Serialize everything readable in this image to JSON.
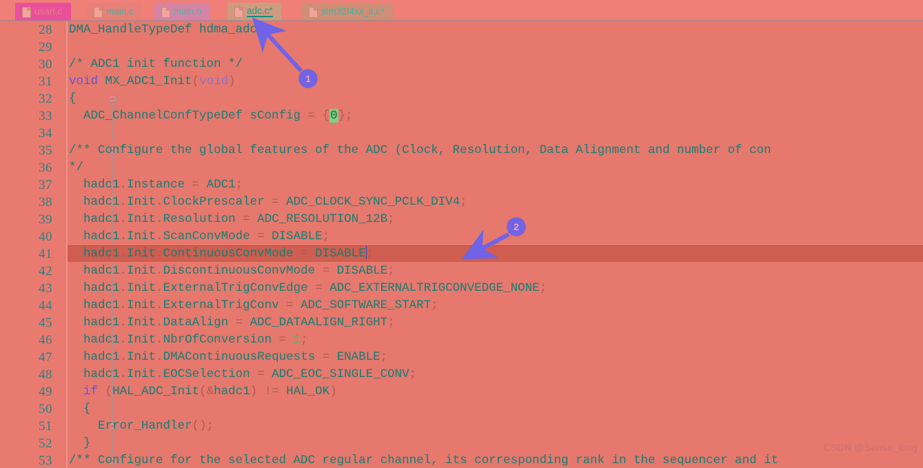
{
  "window": {
    "watermark": "CSDN @Sense_long"
  },
  "tabbar": {
    "tabs": [
      {
        "label": "usart.c",
        "icon": "file-icon",
        "active": false,
        "modified": false
      },
      {
        "label": "main.c",
        "icon": "file-icon",
        "active": false,
        "modified": false
      },
      {
        "label": "main.h",
        "icon": "file-icon",
        "active": false,
        "modified": false
      },
      {
        "label": "adc.c*",
        "icon": "file-icon",
        "active": true,
        "modified": true
      },
      {
        "label": "stm32f4xx_it.c*",
        "icon": "file-icon",
        "active": false,
        "modified": true
      }
    ]
  },
  "editor": {
    "active_line": 41,
    "first_visible_line": 28,
    "last_visible_line": 53,
    "colors": {
      "background": "#e6786e",
      "current_line": "#cf5d50",
      "line_number": "#2a7f84",
      "identifier": "#147e72",
      "keyword": "#6b4fd8",
      "comment": "#9b51c4",
      "number": "#3fc25c",
      "accent_badge": "#6f63e8"
    },
    "lines": [
      {
        "n": "28",
        "text": "DMA_HandleTypeDef hdma_adc1;"
      },
      {
        "n": "29",
        "text": ""
      },
      {
        "n": "30",
        "text": "/* ADC1 init function */"
      },
      {
        "n": "31",
        "text": "void MX_ADC1_Init(void)"
      },
      {
        "n": "32",
        "text": "{"
      },
      {
        "n": "33",
        "text": "  ADC_ChannelConfTypeDef sConfig = {0};"
      },
      {
        "n": "34",
        "text": ""
      },
      {
        "n": "35",
        "text": "  /** Configure the global features of the ADC (Clock, Resolution, Data Alignment and number of con"
      },
      {
        "n": "36",
        "text": "  */"
      },
      {
        "n": "37",
        "text": "  hadc1.Instance = ADC1;"
      },
      {
        "n": "38",
        "text": "  hadc1.Init.ClockPrescaler = ADC_CLOCK_SYNC_PCLK_DIV4;"
      },
      {
        "n": "39",
        "text": "  hadc1.Init.Resolution = ADC_RESOLUTION_12B;"
      },
      {
        "n": "40",
        "text": "  hadc1.Init.ScanConvMode = DISABLE;"
      },
      {
        "n": "41",
        "text": "  hadc1.Init.ContinuousConvMode = DISABLE;"
      },
      {
        "n": "42",
        "text": "  hadc1.Init.DiscontinuousConvMode = DISABLE;"
      },
      {
        "n": "43",
        "text": "  hadc1.Init.ExternalTrigConvEdge = ADC_EXTERNALTRIGCONVEDGE_NONE;"
      },
      {
        "n": "44",
        "text": "  hadc1.Init.ExternalTrigConv = ADC_SOFTWARE_START;"
      },
      {
        "n": "45",
        "text": "  hadc1.Init.DataAlign = ADC_DATAALIGN_RIGHT;"
      },
      {
        "n": "46",
        "text": "  hadc1.Init.NbrOfConversion = 1;"
      },
      {
        "n": "47",
        "text": "  hadc1.Init.DMAContinuousRequests = ENABLE;"
      },
      {
        "n": "48",
        "text": "  hadc1.Init.EOCSelection = ADC_EOC_SINGLE_CONV;"
      },
      {
        "n": "49",
        "text": "  if (HAL_ADC_Init(&hadc1) != HAL_OK)"
      },
      {
        "n": "50",
        "text": "  {"
      },
      {
        "n": "51",
        "text": "    Error_Handler();"
      },
      {
        "n": "52",
        "text": "  }"
      },
      {
        "n": "53",
        "text": "  /** Configure for the selected ADC regular channel, its corresponding rank in the sequencer and it"
      }
    ]
  },
  "annotations": {
    "callouts": [
      {
        "label": "1",
        "target": "adc.c-tab"
      },
      {
        "label": "2",
        "target": "line-41-continuous-conv-mode"
      }
    ]
  }
}
